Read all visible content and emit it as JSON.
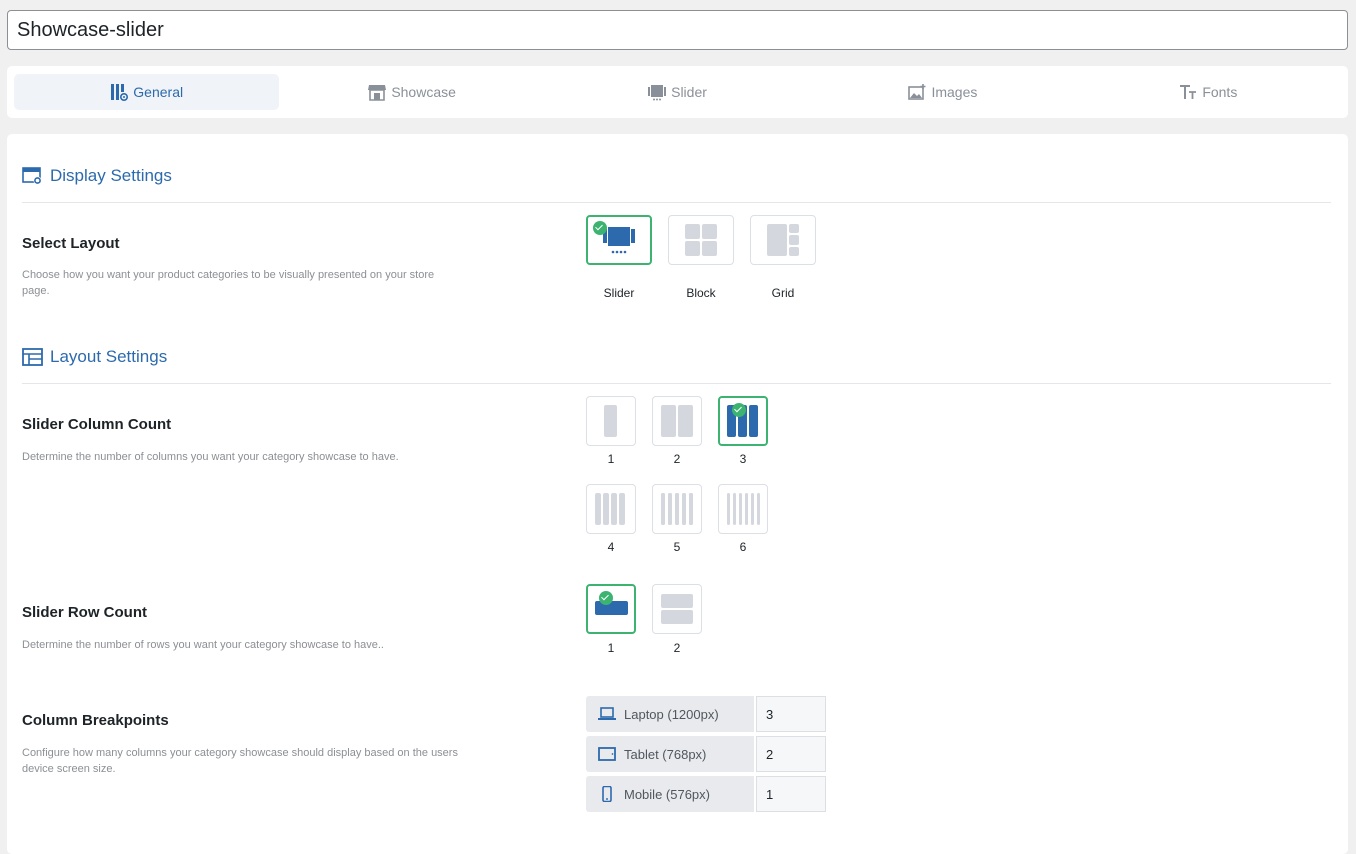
{
  "post_title": "Showcase-slider",
  "tabs": [
    {
      "label": "General",
      "icon": "columns-gear-icon"
    },
    {
      "label": "Showcase",
      "icon": "storefront-icon"
    },
    {
      "label": "Slider",
      "icon": "slider-icon"
    },
    {
      "label": "Images",
      "icon": "images-icon"
    },
    {
      "label": "Fonts",
      "icon": "fonts-icon"
    }
  ],
  "display_settings": {
    "heading": "Display Settings",
    "select_layout": {
      "title": "Select Layout",
      "description": "Choose how you want your product categories to be visually presented on your store page.",
      "options": [
        "Slider",
        "Block",
        "Grid"
      ],
      "selected": "Slider"
    }
  },
  "layout_settings": {
    "heading": "Layout Settings",
    "column_count": {
      "title": "Slider Column Count",
      "description": "Determine the number of columns you want your category showcase to have.",
      "options": [
        "1",
        "2",
        "3",
        "4",
        "5",
        "6"
      ],
      "selected": "3"
    },
    "row_count": {
      "title": "Slider Row Count",
      "description": "Determine the number of rows you want your category showcase to have..",
      "options": [
        "1",
        "2"
      ],
      "selected": "1"
    },
    "breakpoints": {
      "title": "Column Breakpoints",
      "description": "Configure how many columns your category showcase should display based on the users device screen size.",
      "rows": [
        {
          "label": "Laptop (1200px)",
          "value": "3",
          "icon": "laptop-icon"
        },
        {
          "label": "Tablet (768px)",
          "value": "2",
          "icon": "tablet-icon"
        },
        {
          "label": "Mobile (576px)",
          "value": "1",
          "icon": "mobile-icon"
        }
      ]
    }
  },
  "colors": {
    "accent": "#2c6aad",
    "selected_border": "#3cb371",
    "inactive_icon": "#d4d8de"
  }
}
